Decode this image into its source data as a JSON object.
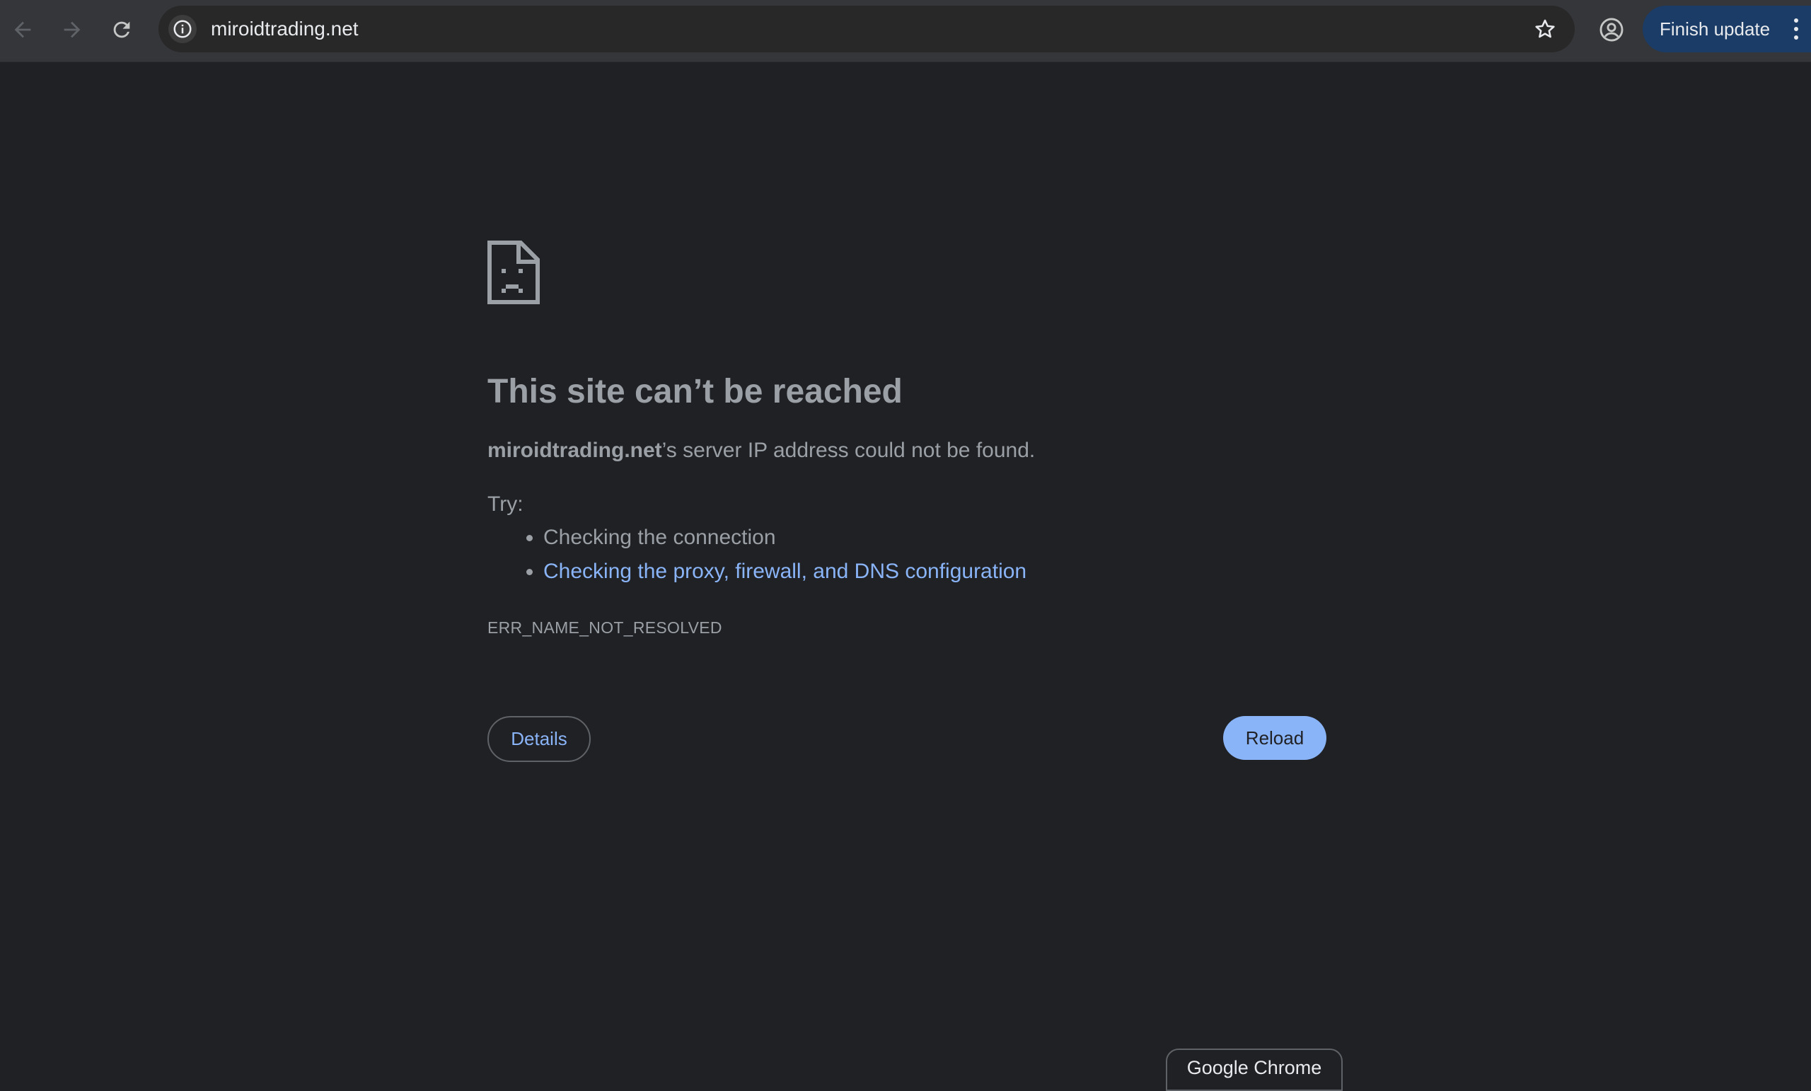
{
  "toolbar": {
    "url": "miroidtrading.net",
    "update_button_label": "Finish update",
    "icons": {
      "back": "arrow-left-icon",
      "forward": "arrow-right-icon",
      "reload": "reload-icon",
      "site_info": "info-icon",
      "bookmark": "star-icon",
      "profile": "account-circle-icon",
      "menu": "kebab-menu-icon"
    }
  },
  "error_page": {
    "icon": "sad-document-icon",
    "title": "This site can’t be reached",
    "description_domain": "miroidtrading.net",
    "description_rest": "’s server IP address could not be found.",
    "try_label": "Try:",
    "suggestions": [
      {
        "text": "Checking the connection",
        "is_link": false
      },
      {
        "text": "Checking the proxy, firewall, and DNS configuration",
        "is_link": true
      }
    ],
    "error_code": "ERR_NAME_NOT_RESOLVED",
    "details_label": "Details",
    "reload_label": "Reload"
  },
  "footer_chip": {
    "label": "Google Chrome"
  },
  "colors": {
    "page_background": "#202124",
    "toolbar_background": "#35363a",
    "text_secondary": "#9aa0a6",
    "link": "#8ab4f8",
    "update_button": "#1a3c66"
  }
}
